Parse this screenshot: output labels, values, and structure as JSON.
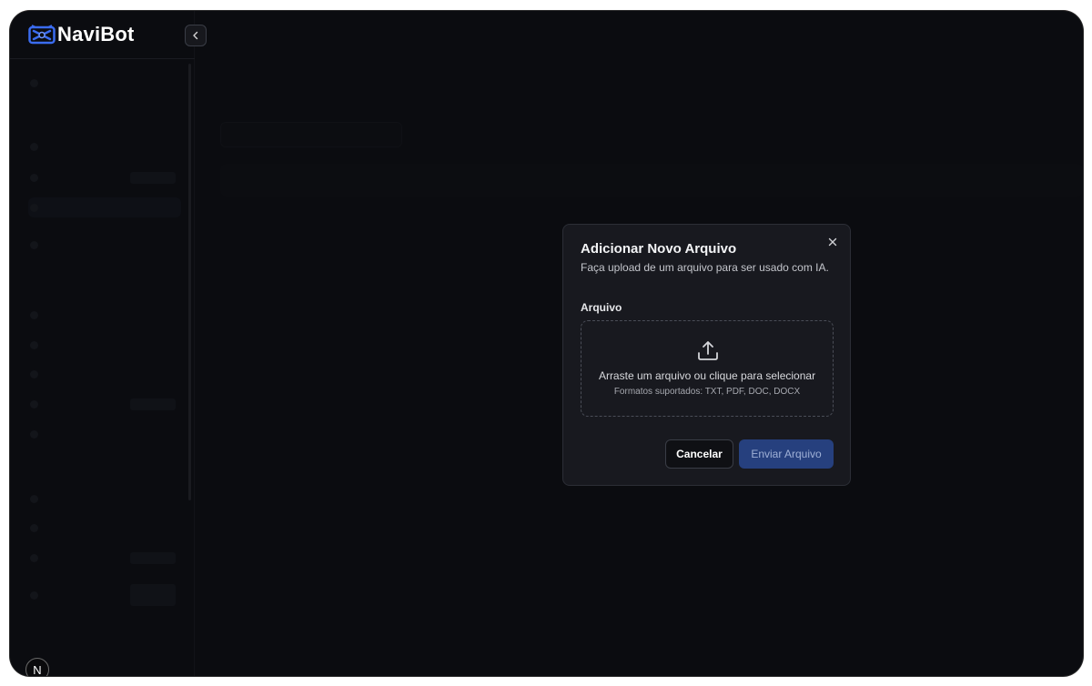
{
  "brand": {
    "name": "NaviBot",
    "logo_icon": "navibot-logo-icon"
  },
  "sidebar": {
    "collapse_icon": "chevron-left-icon",
    "avatar_initial": "N"
  },
  "modal": {
    "title": "Adicionar Novo Arquivo",
    "description": "Faça upload de um arquivo para ser usado com IA.",
    "field_label": "Arquivo",
    "dropzone": {
      "icon": "upload-icon",
      "text": "Arraste um arquivo ou clique para selecionar",
      "subtext": "Formatos suportados: TXT, PDF, DOC, DOCX"
    },
    "close_icon": "close-icon",
    "cancel_label": "Cancelar",
    "submit_label": "Enviar Arquivo"
  },
  "colors": {
    "background": "#0b0c10",
    "modal": "#18191f",
    "primary_button": "#26407e",
    "brand_blue": "#3b6cf0"
  }
}
